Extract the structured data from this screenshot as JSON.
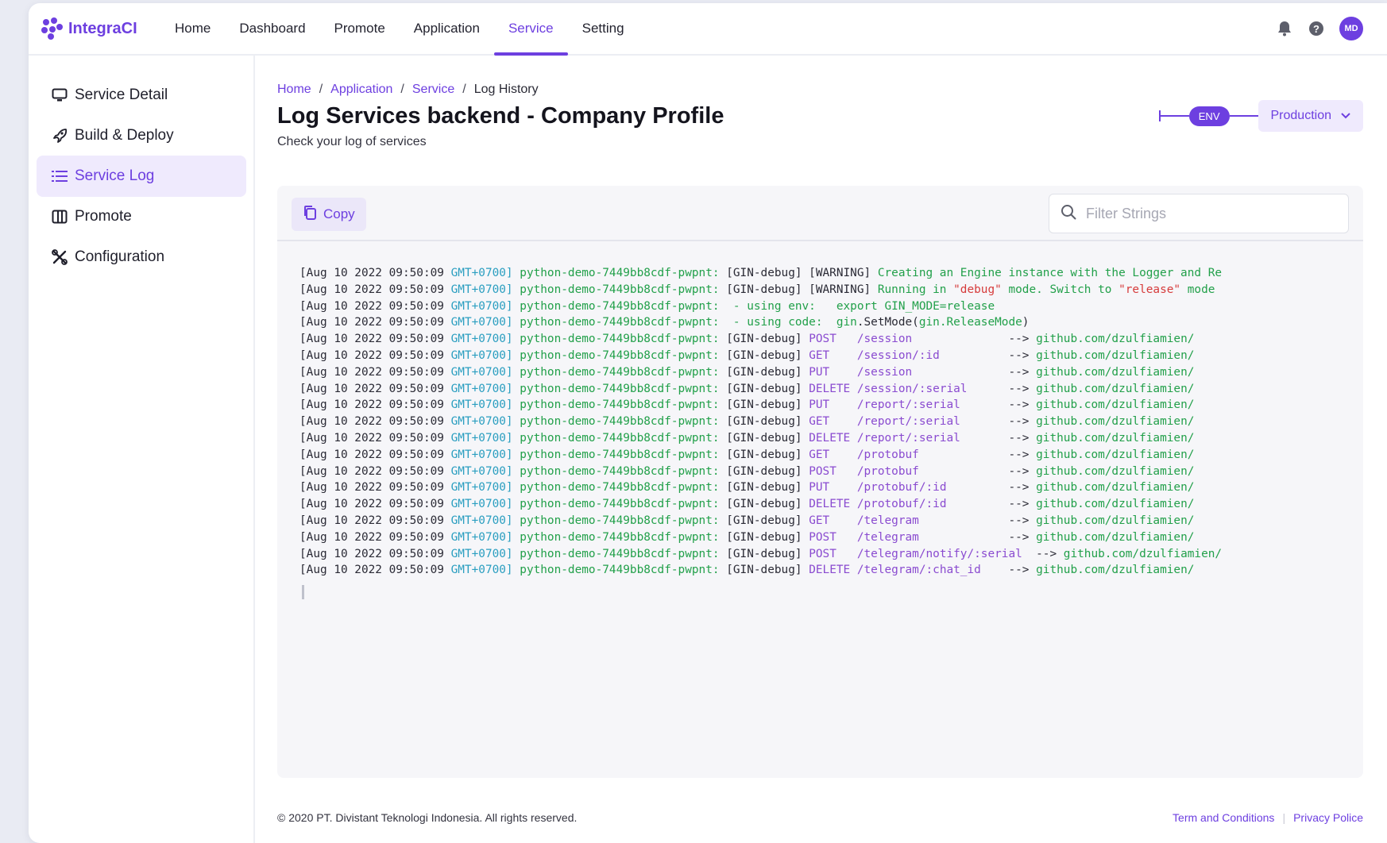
{
  "app": {
    "name": "IntegraCI",
    "brand_color": "#6d3fe0"
  },
  "topnav": {
    "items": [
      {
        "label": "Home"
      },
      {
        "label": "Dashboard"
      },
      {
        "label": "Promote"
      },
      {
        "label": "Application"
      },
      {
        "label": "Service",
        "active": true
      },
      {
        "label": "Setting"
      }
    ],
    "avatar_initials": "MD"
  },
  "sidebar": {
    "items": [
      {
        "label": "Service Detail",
        "icon": "monitor-icon"
      },
      {
        "label": "Build & Deploy",
        "icon": "rocket-icon"
      },
      {
        "label": "Service Log",
        "icon": "list-icon",
        "active": true
      },
      {
        "label": "Promote",
        "icon": "columns-icon"
      },
      {
        "label": "Configuration",
        "icon": "tools-icon"
      }
    ]
  },
  "breadcrumb": {
    "home": "Home",
    "application": "Application",
    "service": "Service",
    "current": "Log History",
    "sep": "/"
  },
  "page": {
    "title": "Log Services backend - Company Profile",
    "subtitle": "Check your log of services"
  },
  "env": {
    "badge": "ENV",
    "selected": "Production"
  },
  "toolbar": {
    "copy_label": "Copy",
    "filter_placeholder": "Filter Strings",
    "filter_value": ""
  },
  "log": {
    "timestamp": "[Aug 10 2022 09:50:09",
    "tz": "GMT+0700]",
    "pod": "python-demo-7449bb8cdf-pwpnt:",
    "lines": [
      {
        "tag": "[GIN-debug] [WARNING]",
        "msg": " Creating an Engine instance with the Logger and Re"
      },
      {
        "tag": "[GIN-debug] [WARNING]",
        "msg1": " Running in ",
        "red1": "\"debug\"",
        "msg2": " mode. Switch to ",
        "red2": "\"release\"",
        "msg3": " mode"
      },
      {
        "tag": " - using env:",
        "msg": "   export GIN_MODE=release"
      },
      {
        "tag": " - using code:",
        "code1": "  gin",
        "code2": ".SetMode(",
        "code3": "gin.ReleaseMode",
        "code4": ")"
      },
      {
        "tag": "[GIN-debug]",
        "method": "POST  ",
        "path": " /session            ",
        "arrow": "  -->",
        "link": " github.com/dzulfiamien/"
      },
      {
        "tag": "[GIN-debug]",
        "method": "GET   ",
        "path": " /session/:id        ",
        "arrow": "  -->",
        "link": " github.com/dzulfiamien/"
      },
      {
        "tag": "[GIN-debug]",
        "method": "PUT   ",
        "path": " /session            ",
        "arrow": "  -->",
        "link": " github.com/dzulfiamien/"
      },
      {
        "tag": "[GIN-debug]",
        "method": "DELETE",
        "path": " /session/:serial    ",
        "arrow": "  -->",
        "link": " github.com/dzulfiamien/"
      },
      {
        "tag": "[GIN-debug]",
        "method": "PUT   ",
        "path": " /report/:serial     ",
        "arrow": "  -->",
        "link": " github.com/dzulfiamien/"
      },
      {
        "tag": "[GIN-debug]",
        "method": "GET   ",
        "path": " /report/:serial     ",
        "arrow": "  -->",
        "link": " github.com/dzulfiamien/"
      },
      {
        "tag": "[GIN-debug]",
        "method": "DELETE",
        "path": " /report/:serial     ",
        "arrow": "  -->",
        "link": " github.com/dzulfiamien/"
      },
      {
        "tag": "[GIN-debug]",
        "method": "GET   ",
        "path": " /protobuf           ",
        "arrow": "  -->",
        "link": " github.com/dzulfiamien/"
      },
      {
        "tag": "[GIN-debug]",
        "method": "POST  ",
        "path": " /protobuf           ",
        "arrow": "  -->",
        "link": " github.com/dzulfiamien/"
      },
      {
        "tag": "[GIN-debug]",
        "method": "PUT   ",
        "path": " /protobuf/:id       ",
        "arrow": "  -->",
        "link": " github.com/dzulfiamien/"
      },
      {
        "tag": "[GIN-debug]",
        "method": "DELETE",
        "path": " /protobuf/:id       ",
        "arrow": "  -->",
        "link": " github.com/dzulfiamien/"
      },
      {
        "tag": "[GIN-debug]",
        "method": "GET   ",
        "path": " /telegram           ",
        "arrow": "  -->",
        "link": " github.com/dzulfiamien/"
      },
      {
        "tag": "[GIN-debug]",
        "method": "POST  ",
        "path": " /telegram           ",
        "arrow": "  -->",
        "link": " github.com/dzulfiamien/"
      },
      {
        "tag": "[GIN-debug]",
        "method": "POST  ",
        "path": " /telegram/notify/:serial",
        "arrow": "  -->",
        "link": " github.com/dzulfiamien/"
      },
      {
        "tag": "[GIN-debug]",
        "method": "DELETE",
        "path": " /telegram/:chat_id  ",
        "arrow": "  -->",
        "link": " github.com/dzulfiamien/"
      }
    ]
  },
  "footer": {
    "copyright": "© 2020 PT. Divistant Teknologi Indonesia. All rights reserved.",
    "terms": "Term and Conditions",
    "privacy": "Privacy Police"
  }
}
